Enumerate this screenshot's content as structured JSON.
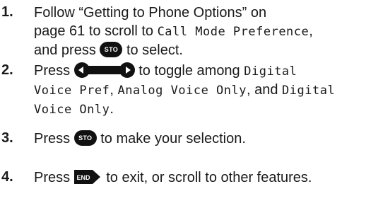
{
  "steps": [
    {
      "number": "1.",
      "l1": "Follow “Getting to Phone Options” on",
      "l2_pre": "page 61 to scroll to ",
      "l2_lcd": "Call Mode Preference",
      "l2_post": ",",
      "l3_pre": "and press ",
      "l3_post": " to select."
    },
    {
      "number": "2.",
      "l1_pre": "Press ",
      "l1_mid": " to toggle among ",
      "l1_lcd": "Digital",
      "l2_lcd_a": "Voice Pref",
      "l2_sep1": ", ",
      "l2_lcd_b": "Analog Voice Only",
      "l2_sep2": ", and ",
      "l2_lcd_c": "Digital",
      "l3_lcd": "Voice Only",
      "l3_post": "."
    },
    {
      "number": "3.",
      "pre": "Press ",
      "post": " to make your selection."
    },
    {
      "number": "4.",
      "pre": "Press ",
      "post": " to exit, or scroll to other features."
    }
  ],
  "keys": {
    "sto": "STO",
    "end": "END"
  }
}
